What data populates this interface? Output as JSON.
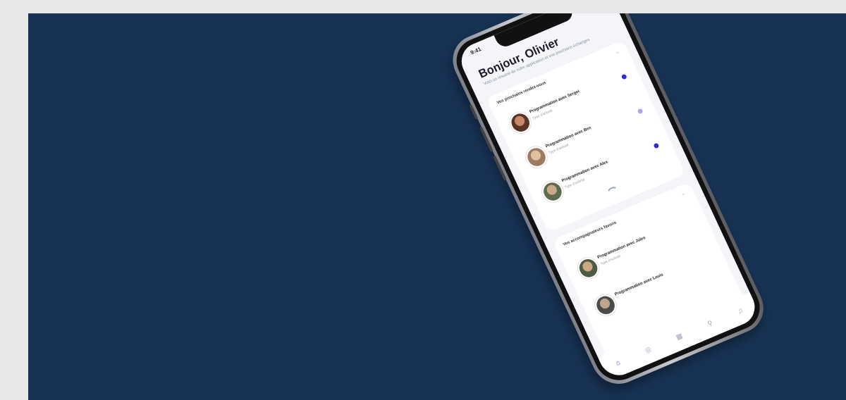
{
  "status_bar": {
    "time": "9:41",
    "icons": "▂▄▆ ◠ ▭"
  },
  "home": {
    "greeting": "Bonjour, Olivier",
    "subtitle": "Voici un résumé de votre application et vos prochains échanges",
    "sections": [
      {
        "title": "Vos prochains rendez-vous",
        "chevron": "⌄",
        "items": [
          {
            "title": "Programmation avec Sergei",
            "subtitle": "Type d'activité",
            "dot_color": "#2f2bd4"
          },
          {
            "title": "Programmation avec Ben",
            "subtitle": "Type d'activité",
            "dot_color": "#a9a6ef"
          },
          {
            "title": "Programmation avec Alex",
            "subtitle": "Type d'activité",
            "dot_color": "#2f2bd4"
          }
        ]
      },
      {
        "title": "Vos accompagnateurs favoris",
        "chevron": "⌄",
        "items": [
          {
            "title": "Programmation avec Jules",
            "subtitle": "Type d'activité"
          },
          {
            "title": "Programmation avec Louis",
            "subtitle": ""
          }
        ]
      }
    ]
  },
  "tabbar": {
    "tabs": [
      {
        "icon": "home-icon",
        "glyph": "⌂",
        "active": true
      },
      {
        "icon": "compass-icon",
        "glyph": "◎",
        "active": false
      },
      {
        "icon": "grid-icon",
        "glyph": "▦",
        "active": false
      },
      {
        "icon": "search-icon",
        "glyph": "⚲",
        "active": false
      },
      {
        "icon": "bell-icon",
        "glyph": "♫",
        "active": false
      }
    ]
  },
  "colors": {
    "background": "#173253",
    "accent": "#2f2bd4"
  }
}
